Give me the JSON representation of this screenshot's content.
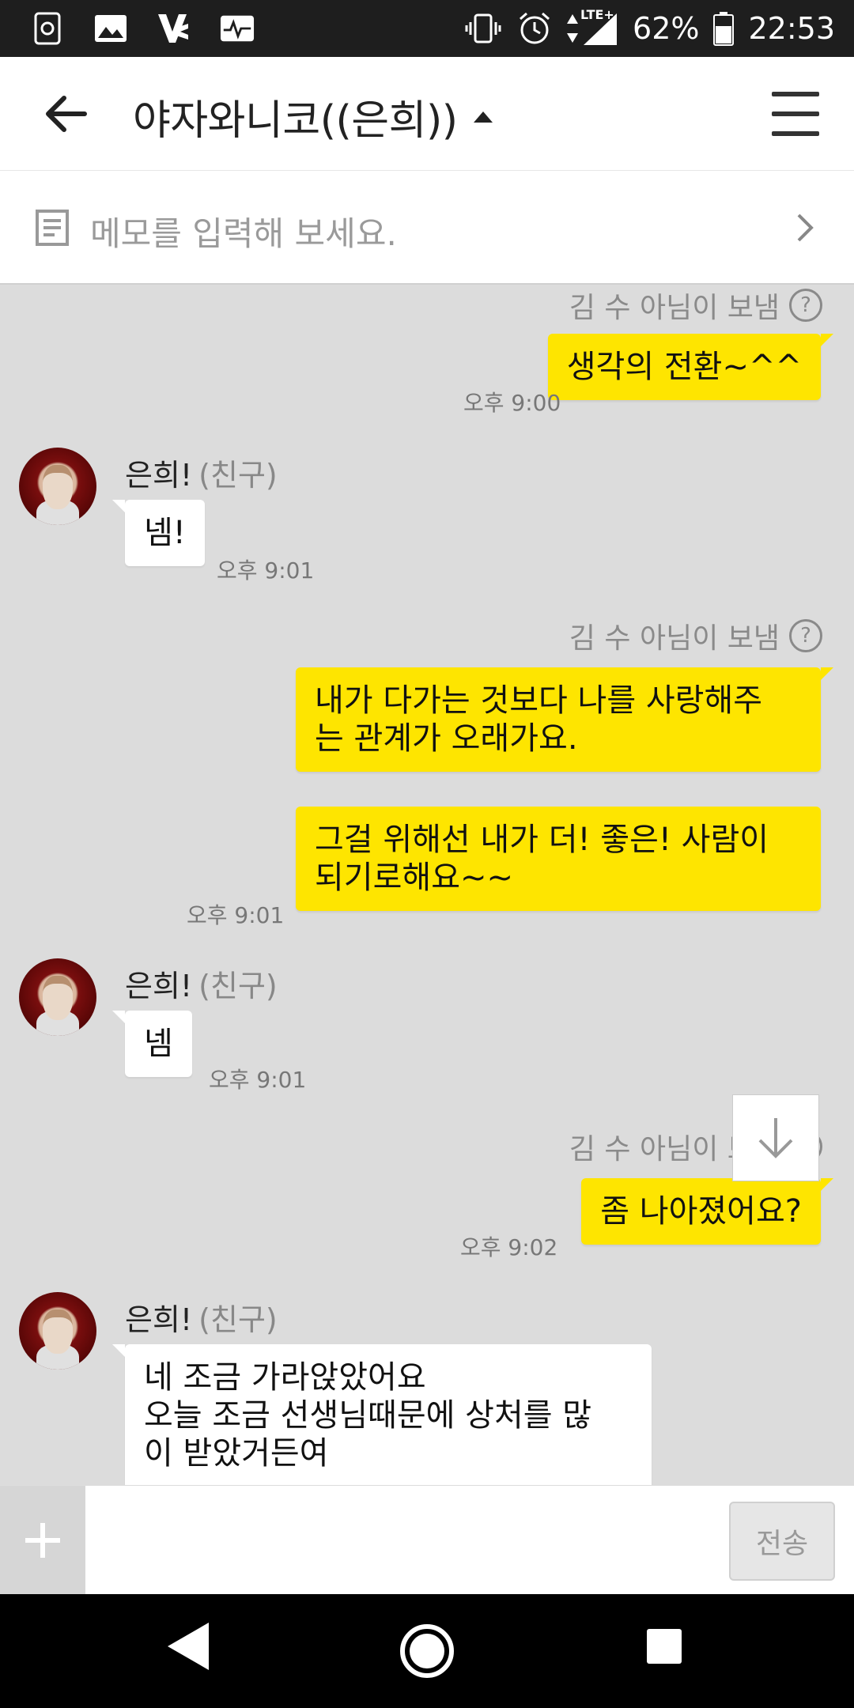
{
  "status_bar": {
    "battery": "62%",
    "time": "22:53",
    "network": "LTE+",
    "left_icons": [
      "screen-capture-icon",
      "gallery-icon",
      "v-app-icon",
      "activity-icon"
    ],
    "right_icons": [
      "vibrate-icon",
      "alarm-icon",
      "data-arrows-icon",
      "signal-icon",
      "battery-icon"
    ]
  },
  "header": {
    "title": "야자와니코((은희))",
    "back_icon": "back-arrow-icon",
    "menu_icon": "hamburger-menu-icon"
  },
  "memo": {
    "placeholder": "메모를 입력해 보세요."
  },
  "messages": [
    {
      "type": "note",
      "text": "김 수 아님이 보냄"
    },
    {
      "type": "me",
      "text": "생각의 전환~^^",
      "time": "오후 9:00"
    },
    {
      "type": "sender",
      "name": "은희!",
      "relation": "(친구)"
    },
    {
      "type": "you",
      "text": "넴!",
      "time": "오후 9:01"
    },
    {
      "type": "note",
      "text": "김 수 아님이 보냄"
    },
    {
      "type": "me",
      "line1": "내가 다가는 것보다 나를 사랑해주",
      "line2": "는 관계가 오래가요."
    },
    {
      "type": "me",
      "line1": "그걸 위해선 내가 더! 좋은! 사람이",
      "line2": "되기로해요~~",
      "time": "오후 9:01"
    },
    {
      "type": "sender",
      "name": "은희!",
      "relation": "(친구)"
    },
    {
      "type": "you",
      "text": "넴",
      "time": "오후 9:01"
    },
    {
      "type": "note",
      "text": "김 수 아님이 보냄"
    },
    {
      "type": "me",
      "text": "좀 나아졌어요?",
      "time": "오후 9:02"
    },
    {
      "type": "sender",
      "name": "은희!",
      "relation": "(친구)"
    },
    {
      "type": "you",
      "line1": "네 조금 가라앉았어요",
      "line2": "오늘 조금 선생님때문에 상처를 많",
      "line3": "이 받았거든여"
    }
  ],
  "input": {
    "value": "",
    "send_label": "전송"
  },
  "colors": {
    "my_bubble": "#fee500",
    "chat_background": "#dcdcdc"
  }
}
